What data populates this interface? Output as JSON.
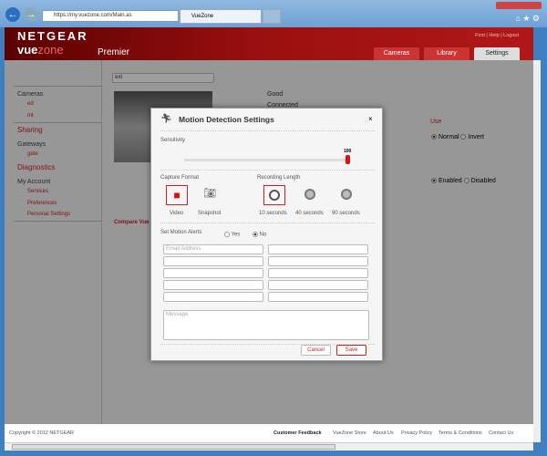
{
  "browser": {
    "url": "https://my.vuezone.com/Main.as",
    "tab_title": "VueZone"
  },
  "header": {
    "brand": "NETGEAR",
    "product_a": "vue",
    "product_b": "zone",
    "tier": "Premier",
    "top_links": [
      "First",
      "Help",
      "Logout"
    ],
    "tabs": [
      {
        "label": "Cameras"
      },
      {
        "label": "Library"
      },
      {
        "label": "Settings",
        "active": true
      }
    ]
  },
  "sidebar": {
    "cameras": "Cameras",
    "camera_items": [
      "ed",
      "mt"
    ],
    "sharing": "Sharing",
    "gateways": "Gateways",
    "gateway_items": [
      "gate"
    ],
    "diagnostics": "Diagnostics",
    "my_account": "My Account",
    "account_items": [
      "Services",
      "Preferences",
      "Personal Settings"
    ]
  },
  "content": {
    "camera_name": "ext",
    "signal": "Good",
    "connected": "Connected",
    "use_label": "Use",
    "orientation": {
      "normal": "Normal",
      "invert": "Invert"
    },
    "status": {
      "enabled": "Enabled",
      "disabled": "Disabled"
    },
    "compare": "Compare Vue"
  },
  "modal": {
    "title": "Motion Detection Settings",
    "close": "×",
    "sensitivity_label": "Sensitivity",
    "sensitivity_value": "100",
    "sensitivity_fraction": 1.0,
    "capture_format_label": "Capture Format",
    "capture_options": [
      "Video",
      "Snapshot"
    ],
    "capture_selected": "Video",
    "recording_length_label": "Recording Length",
    "recording_options": [
      "10 seconds",
      "40 seconds",
      "90 seconds"
    ],
    "recording_selected": "10 seconds",
    "alerts_label": "Set Motion Alerts",
    "alerts_yes": "Yes",
    "alerts_no": "No",
    "alerts_selected": "No",
    "email_placeholder": "Email Address",
    "message_placeholder": "Message",
    "cancel": "Cancel",
    "save": "Save"
  },
  "footer": {
    "copyright": "Copyright © 2012 NETGEAR",
    "links": [
      "Customer Feedback",
      "VueZone Store",
      "About Us",
      "Privacy Policy",
      "Terms & Conditions",
      "Contact Us"
    ]
  },
  "colors": {
    "brand_red": "#b01818",
    "accent": "#cc2222"
  }
}
